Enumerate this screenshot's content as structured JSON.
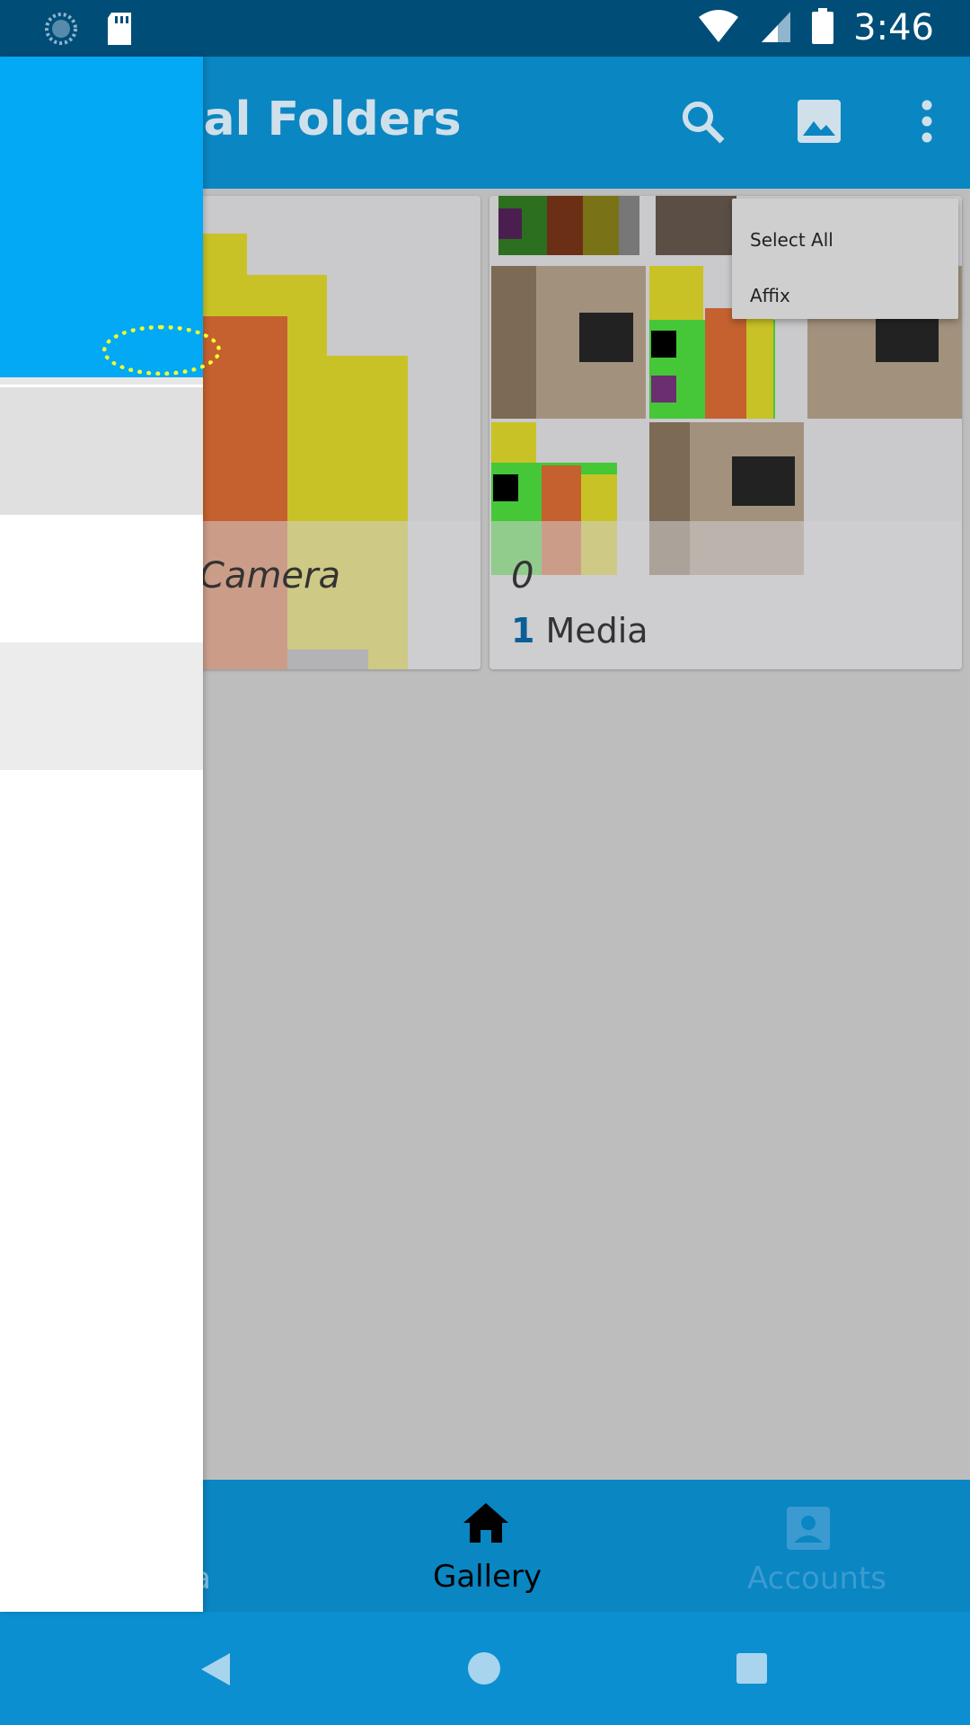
{
  "status_bar": {
    "time": "3:46",
    "icons": [
      "sync-icon",
      "sd-card-icon",
      "wifi-icon",
      "signal-icon",
      "battery-icon"
    ]
  },
  "app_bar": {
    "title": "ocal Folders",
    "actions": [
      "search-icon",
      "image-icon",
      "more-vert-icon"
    ]
  },
  "folders": [
    {
      "name": "Camera",
      "count": ""
    },
    {
      "name": "0",
      "count": "1",
      "count_label": "Media"
    }
  ],
  "overflow_menu": {
    "items": [
      "Select All",
      "Affix"
    ]
  },
  "bottom_nav": {
    "items": [
      {
        "label": "a",
        "icon": ""
      },
      {
        "label": "Gallery",
        "icon": "home-icon"
      },
      {
        "label": "Accounts",
        "icon": "account-box-icon"
      }
    ]
  },
  "system_nav": [
    "back-icon",
    "home-circle-icon",
    "recents-icon"
  ],
  "colors": {
    "status_bar": "#004e78",
    "app_bar": "#0a86c2",
    "drawer_header": "#03a9f4",
    "accent_number": "#0b5f96",
    "highlight": "#f5ff2a"
  }
}
